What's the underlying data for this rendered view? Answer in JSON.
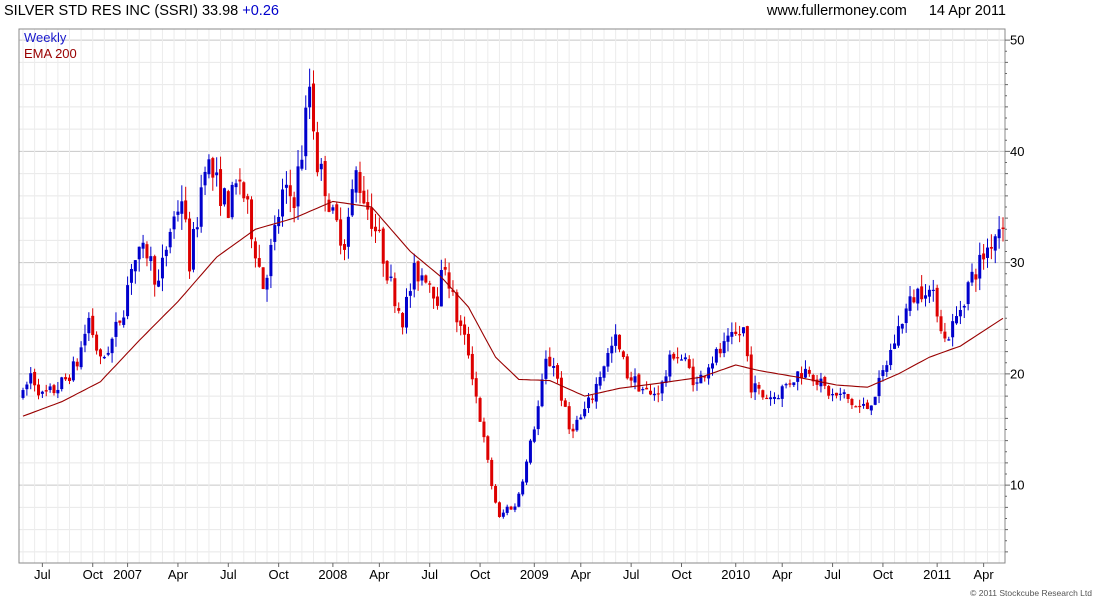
{
  "header": {
    "name": "SILVER STD RES INC (SSRI)",
    "price": "33.98",
    "change": "+0.26",
    "site": "www.fullermoney.com",
    "date": "14 Apr 2011"
  },
  "footer": {
    "copyright": "© 2011 Stockcube Research Ltd"
  },
  "chart_data": {
    "type": "candlestick",
    "title": "SILVER STD RES INC (SSRI) 33.98 +0.26",
    "legend": [
      "Weekly",
      "EMA 200"
    ],
    "legend_position": "top-left",
    "grid": true,
    "colors": {
      "up": "#0000cc",
      "down": "#dd0000",
      "ema": "#990000",
      "grid": "#dcdcdc"
    },
    "x_ticks": [
      "Jul",
      "Oct",
      "2007",
      "Apr",
      "Jul",
      "Oct",
      "2008",
      "Apr",
      "Jul",
      "Oct",
      "2009",
      "Apr",
      "Jul",
      "Oct",
      "2010",
      "Apr",
      "Jul",
      "Oct",
      "2011",
      "Apr"
    ],
    "x_tick_weeks": [
      5,
      18,
      27,
      40,
      53,
      66,
      80,
      92,
      105,
      118,
      132,
      144,
      157,
      170,
      184,
      196,
      209,
      222,
      236,
      248
    ],
    "y_ticks": [
      10,
      20,
      30,
      40,
      50
    ],
    "ylim": [
      3,
      51
    ],
    "n_weeks": 254,
    "series": [
      {
        "name": "Weekly",
        "style": "candlestick",
        "anchors": [
          [
            0,
            18
          ],
          [
            2,
            20
          ],
          [
            5,
            18
          ],
          [
            8,
            18.5
          ],
          [
            11,
            19.5
          ],
          [
            14,
            21
          ],
          [
            17,
            25
          ],
          [
            20,
            21
          ],
          [
            23,
            23
          ],
          [
            26,
            26
          ],
          [
            28,
            30
          ],
          [
            32,
            31
          ],
          [
            35,
            28
          ],
          [
            38,
            33
          ],
          [
            41,
            36
          ],
          [
            43,
            30
          ],
          [
            45,
            34
          ],
          [
            47,
            39.5
          ],
          [
            50,
            37
          ],
          [
            53,
            35
          ],
          [
            56,
            37.5
          ],
          [
            59,
            33
          ],
          [
            62,
            28
          ],
          [
            64,
            31
          ],
          [
            67,
            36
          ],
          [
            70,
            36
          ],
          [
            72,
            40
          ],
          [
            74,
            46
          ],
          [
            76,
            39
          ],
          [
            78,
            37
          ],
          [
            80,
            34
          ],
          [
            83,
            32
          ],
          [
            86,
            38
          ],
          [
            89,
            35
          ],
          [
            92,
            32
          ],
          [
            95,
            28
          ],
          [
            98,
            25
          ],
          [
            101,
            29
          ],
          [
            104,
            29
          ],
          [
            107,
            27
          ],
          [
            109,
            30
          ],
          [
            112,
            25
          ],
          [
            115,
            22
          ],
          [
            118,
            16
          ],
          [
            121,
            10
          ],
          [
            123,
            7
          ],
          [
            125,
            8
          ],
          [
            127,
            8
          ],
          [
            130,
            12
          ],
          [
            133,
            17
          ],
          [
            135,
            21
          ],
          [
            137,
            21
          ],
          [
            139,
            18
          ],
          [
            141,
            15
          ],
          [
            144,
            16
          ],
          [
            147,
            18
          ],
          [
            150,
            21
          ],
          [
            153,
            23
          ],
          [
            156,
            20
          ],
          [
            159,
            19
          ],
          [
            162,
            18
          ],
          [
            165,
            19
          ],
          [
            168,
            22
          ],
          [
            171,
            21
          ],
          [
            174,
            19
          ],
          [
            177,
            21
          ],
          [
            180,
            22
          ],
          [
            183,
            23
          ],
          [
            186,
            24
          ],
          [
            188,
            19
          ],
          [
            191,
            18
          ],
          [
            194,
            18
          ],
          [
            197,
            19
          ],
          [
            200,
            20
          ],
          [
            203,
            20.5
          ],
          [
            206,
            19
          ],
          [
            209,
            18
          ],
          [
            212,
            18
          ],
          [
            215,
            17
          ],
          [
            218,
            17
          ],
          [
            221,
            19
          ],
          [
            224,
            22
          ],
          [
            227,
            25
          ],
          [
            230,
            27
          ],
          [
            233,
            28
          ],
          [
            236,
            26
          ],
          [
            238,
            23
          ],
          [
            241,
            25
          ],
          [
            244,
            28
          ],
          [
            247,
            30
          ],
          [
            250,
            32
          ],
          [
            253,
            34
          ]
        ]
      },
      {
        "name": "EMA 200",
        "style": "line",
        "anchors": [
          [
            0,
            16.2
          ],
          [
            10,
            17.5
          ],
          [
            20,
            19.3
          ],
          [
            30,
            23
          ],
          [
            40,
            26.5
          ],
          [
            50,
            30.5
          ],
          [
            60,
            33
          ],
          [
            70,
            34
          ],
          [
            80,
            35.5
          ],
          [
            90,
            35
          ],
          [
            100,
            31
          ],
          [
            108,
            28.7
          ],
          [
            115,
            26
          ],
          [
            122,
            21.5
          ],
          [
            128,
            19.5
          ],
          [
            136,
            19.4
          ],
          [
            145,
            18
          ],
          [
            154,
            18.7
          ],
          [
            165,
            19.2
          ],
          [
            175,
            19.7
          ],
          [
            184,
            20.8
          ],
          [
            190,
            20.3
          ],
          [
            200,
            19.7
          ],
          [
            210,
            19
          ],
          [
            218,
            18.8
          ],
          [
            226,
            20
          ],
          [
            234,
            21.5
          ],
          [
            242,
            22.5
          ],
          [
            253,
            25
          ]
        ]
      }
    ]
  }
}
